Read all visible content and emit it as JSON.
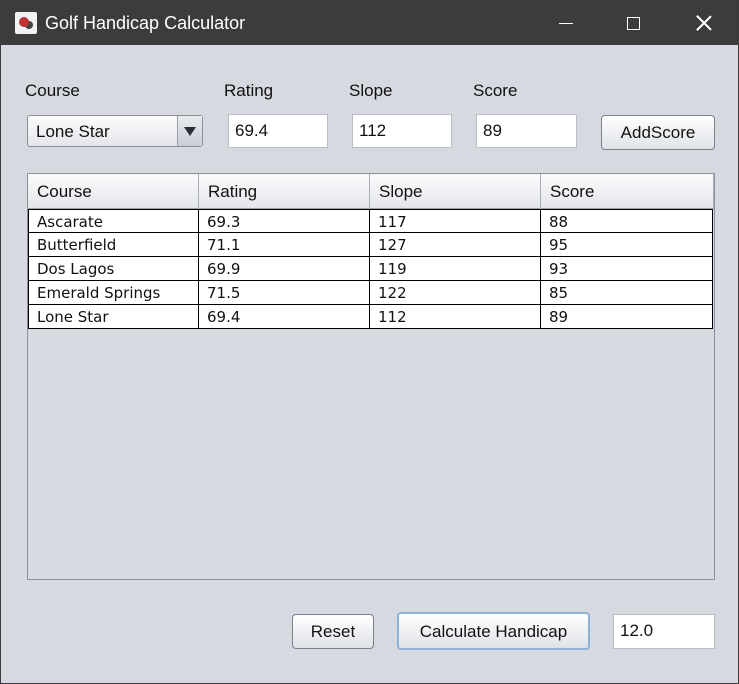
{
  "window": {
    "title": "Golf Handicap Calculator"
  },
  "form": {
    "course_label": "Course",
    "rating_label": "Rating",
    "slope_label": "Slope",
    "score_label": "Score",
    "course_selected": "Lone Star",
    "rating_value": "69.4",
    "slope_value": "112",
    "score_value": "89",
    "add_button": "AddScore"
  },
  "table": {
    "columns": [
      "Course",
      "Rating",
      "Slope",
      "Score"
    ],
    "rows": [
      [
        "Ascarate",
        "69.3",
        "117",
        "88"
      ],
      [
        "Butterfield",
        "71.1",
        "127",
        "95"
      ],
      [
        "Dos Lagos",
        "69.9",
        "119",
        "93"
      ],
      [
        "Emerald Springs",
        "71.5",
        "122",
        "85"
      ],
      [
        "Lone Star",
        "69.4",
        "112",
        "89"
      ]
    ]
  },
  "footer": {
    "reset_button": "Reset",
    "calculate_button": "Calculate Handicap",
    "handicap_value": "12.0"
  },
  "icons": {
    "app": "golf-app-icon",
    "minimize": "minimize-icon",
    "maximize": "maximize-icon",
    "close": "close-icon",
    "dropdown": "chevron-down-icon"
  }
}
